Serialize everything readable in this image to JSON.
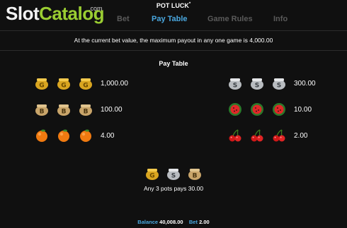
{
  "watermark": {
    "part1": "Slot",
    "part2": "Catalog",
    "suffix": ".com"
  },
  "game": {
    "title": "POT LUCK",
    "mark": "*"
  },
  "tabs": [
    {
      "label": "Bet"
    },
    {
      "label": "Pay Table",
      "active": true
    },
    {
      "label": "Game Rules"
    },
    {
      "label": "Info"
    }
  ],
  "max_payout_text": "At the current bet value, the maximum payout in any one game is 4,000.00",
  "paytable": {
    "title": "Pay Table",
    "left": [
      {
        "symbol": "gold-g-pot-icon",
        "value": "1,000.00"
      },
      {
        "symbol": "bronze-b-pot-icon",
        "value": "100.00"
      },
      {
        "symbol": "orange-icon",
        "value": "4.00"
      }
    ],
    "right": [
      {
        "symbol": "silver-s-pot-icon",
        "value": "300.00"
      },
      {
        "symbol": "watermelon-icon",
        "value": "10.00"
      },
      {
        "symbol": "cherries-icon",
        "value": "2.00"
      }
    ],
    "pots_symbols": [
      "gold-g-pot-icon",
      "silver-s-pot-icon",
      "bronze-b-pot-icon"
    ],
    "any_pots_text": "Any 3 pots pays 30.00"
  },
  "footer": {
    "balance_label": "Balance",
    "balance_value": "40,008.00",
    "bet_label": "Bet",
    "bet_value": "2.00"
  },
  "colors": {
    "background": "#101010",
    "active_tab": "#4aa8e0",
    "inactive_tab": "#5a5a5a",
    "watermark_accent": "#9acd32"
  }
}
